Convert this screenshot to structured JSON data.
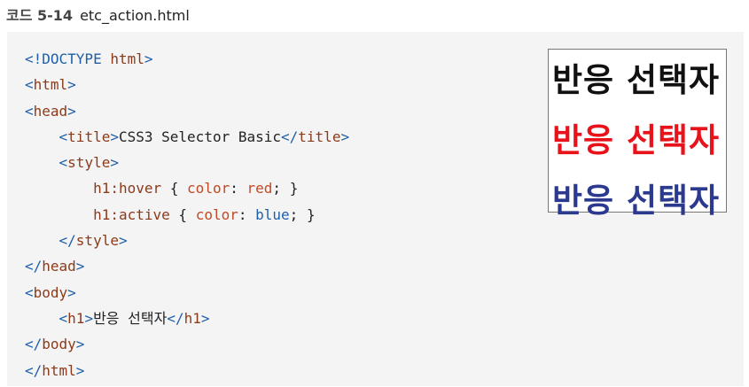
{
  "caption": {
    "label": "코드 5-14",
    "filename": "etc_action.html"
  },
  "code": {
    "l1": {
      "open": "<!DOCTYPE",
      "kw": "html",
      "close": ">"
    },
    "l2": "html",
    "l3": "head",
    "l4": {
      "tag": "title",
      "text": "CSS3 Selector Basic"
    },
    "l5": "style",
    "l6": {
      "sel": "h1:hover",
      "prop": "color",
      "val": "red"
    },
    "l7": {
      "sel": "h1:active",
      "prop": "color",
      "val": "blue"
    },
    "l8": "style",
    "l9": "head",
    "l10": "body",
    "l11": {
      "tag": "h1",
      "text": "반응 선택자"
    },
    "l12": "body",
    "l13": "html"
  },
  "preview": {
    "items": [
      {
        "text": "반응 선택자",
        "color": "#111111"
      },
      {
        "text": "반응 선택자",
        "color": "#e8121b"
      },
      {
        "text": "반응 선택자",
        "color": "#2b3a8e"
      }
    ]
  }
}
